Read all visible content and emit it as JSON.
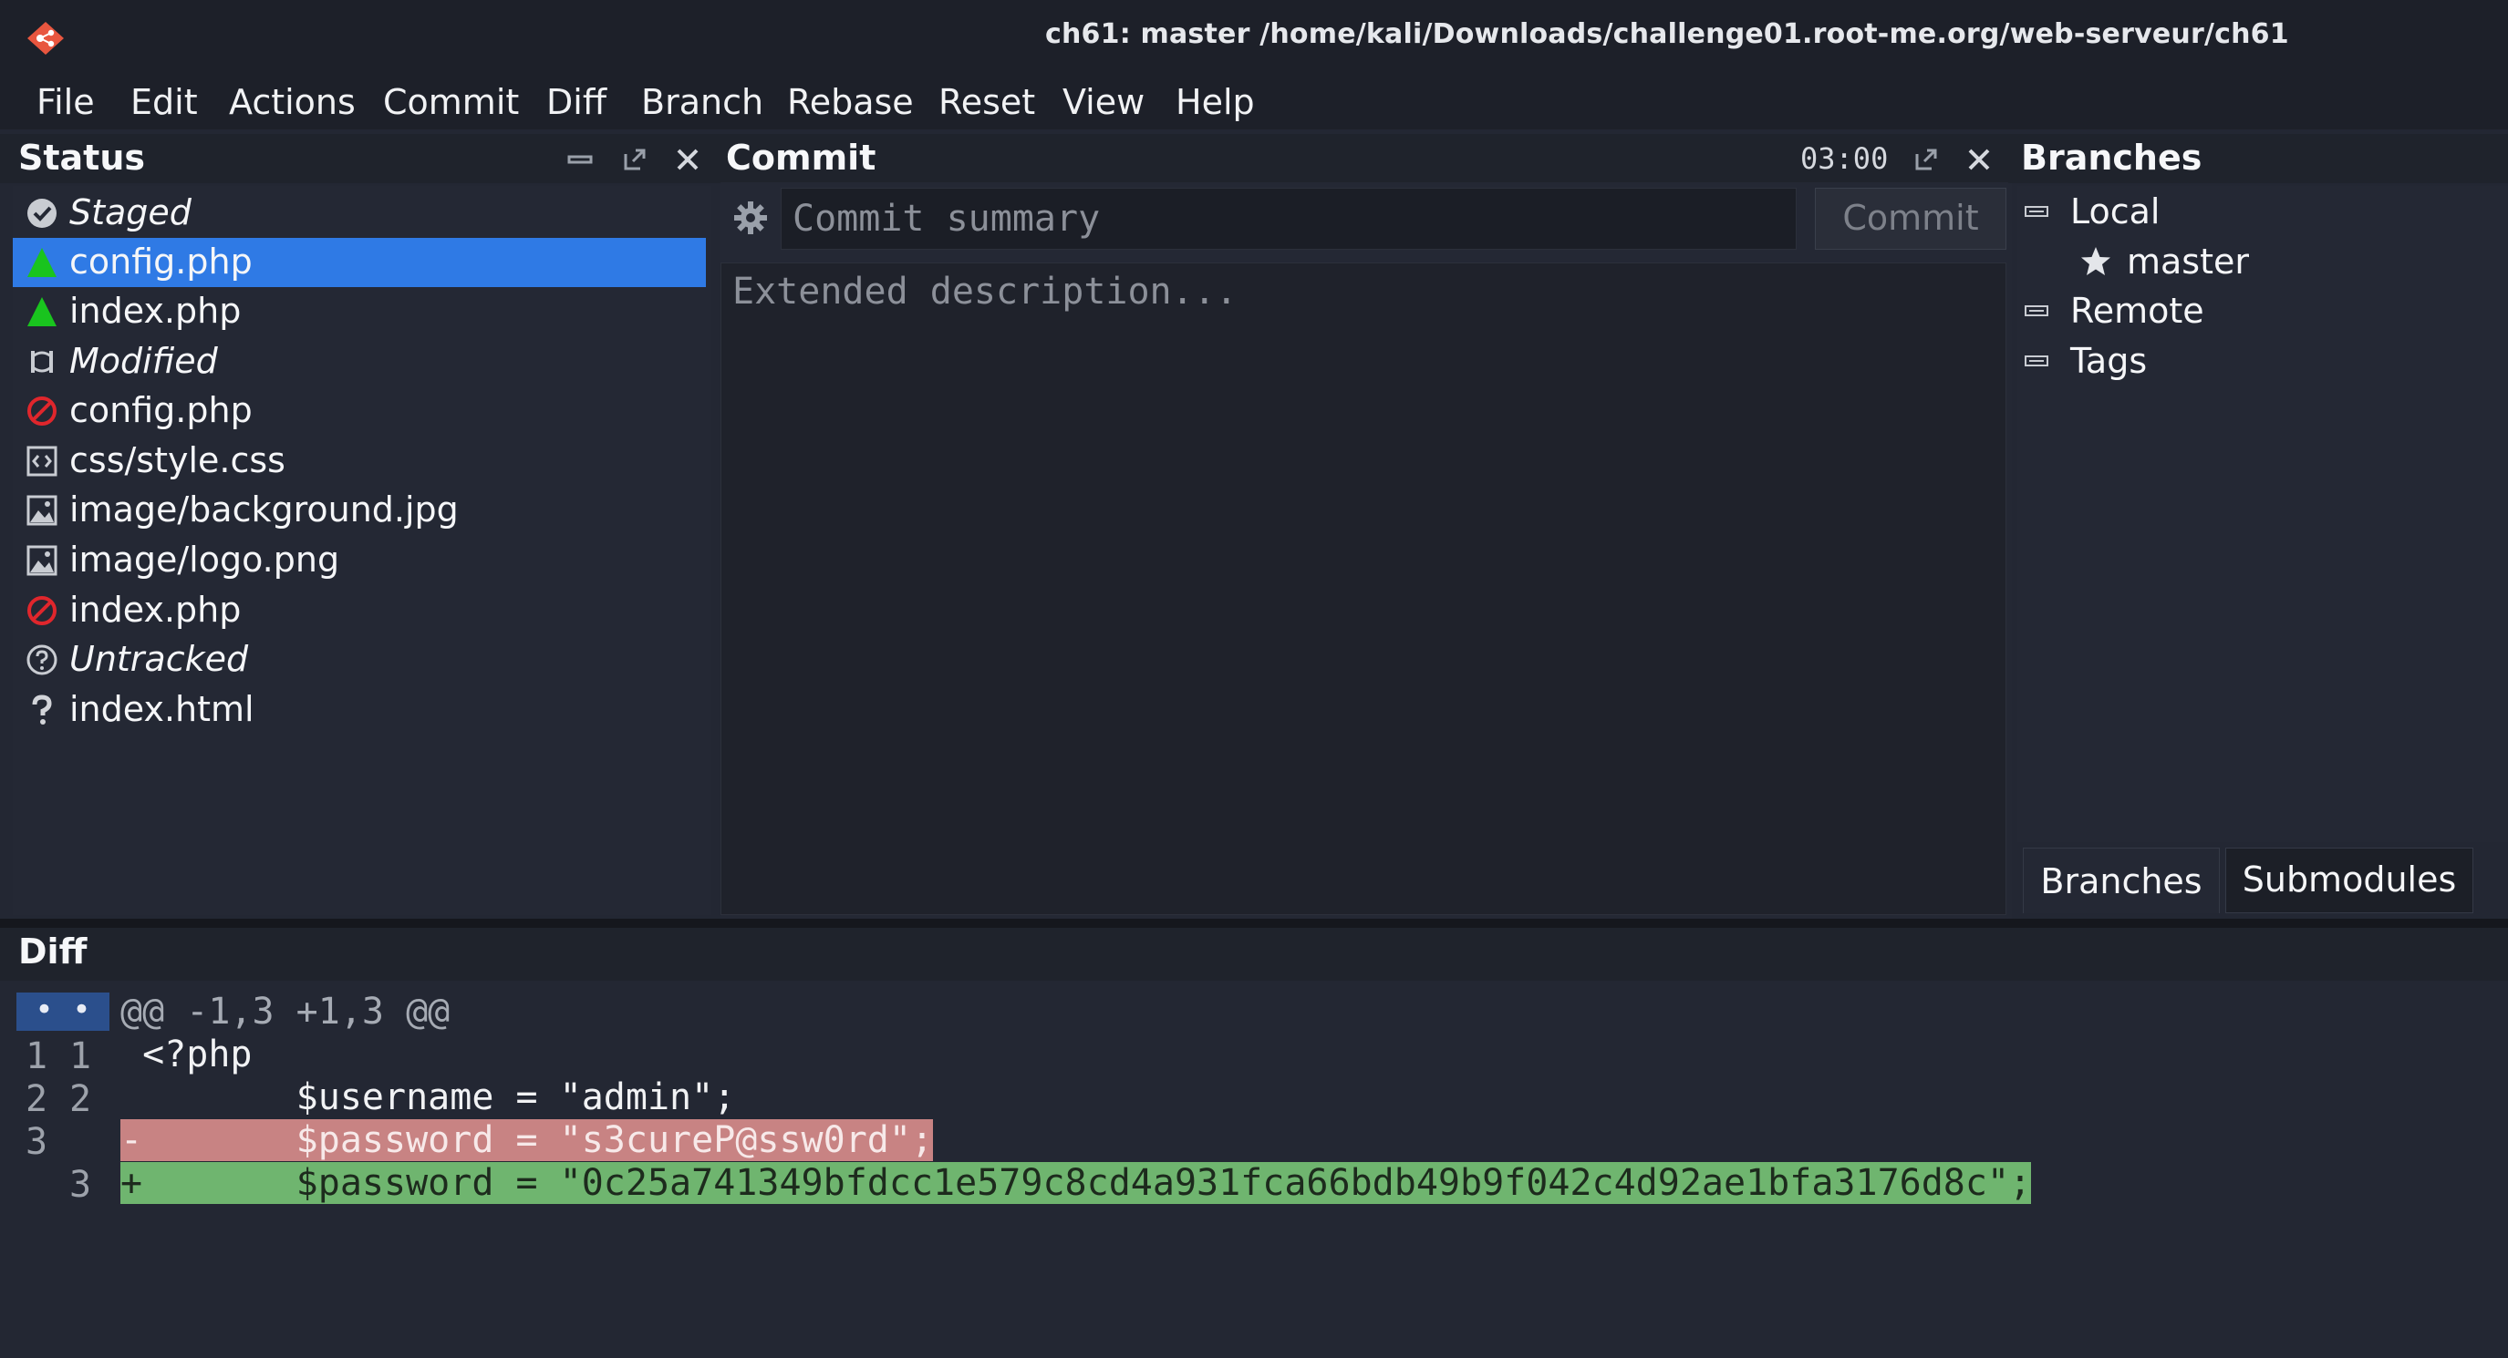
{
  "window": {
    "title": "ch61: master /home/kali/Downloads/challenge01.root-me.org/web-serveur/ch61"
  },
  "menu": [
    "File",
    "Edit",
    "Actions",
    "Commit",
    "Diff",
    "Branch",
    "Rebase",
    "Reset",
    "View",
    "Help"
  ],
  "status_panel": {
    "title": "Status",
    "items": [
      {
        "label": "Staged",
        "type": "group",
        "icon": "check-circle-icon"
      },
      {
        "label": "config.php",
        "type": "file",
        "icon": "added-triangle-icon",
        "selected": true
      },
      {
        "label": "index.php",
        "type": "file",
        "icon": "added-triangle-icon"
      },
      {
        "label": "Modified",
        "type": "group",
        "icon": "modified-icon"
      },
      {
        "label": "config.php",
        "type": "file",
        "icon": "deleted-no-icon"
      },
      {
        "label": "css/style.css",
        "type": "file",
        "icon": "code-file-icon"
      },
      {
        "label": "image/background.jpg",
        "type": "file",
        "icon": "image-file-icon"
      },
      {
        "label": "image/logo.png",
        "type": "file",
        "icon": "image-file-icon"
      },
      {
        "label": "index.php",
        "type": "file",
        "icon": "deleted-no-icon"
      },
      {
        "label": "Untracked",
        "type": "group",
        "icon": "question-circle-icon"
      },
      {
        "label": "index.html",
        "type": "file",
        "icon": "question-mark-icon"
      }
    ]
  },
  "commit_panel": {
    "title": "Commit",
    "timer": "03:00",
    "summary_placeholder": "Commit summary",
    "description_placeholder": "Extended description...",
    "commit_button": "Commit"
  },
  "branches_panel": {
    "title": "Branches",
    "local_label": "Local",
    "current_branch": "master",
    "remote_label": "Remote",
    "tags_label": "Tags",
    "tabs": [
      "Branches",
      "Submodules"
    ]
  },
  "diff_panel": {
    "title": "Diff",
    "hunk_marker": "• •",
    "hunk_header": "@@ -1,3 +1,3 @@",
    "lines": [
      {
        "old": "1",
        "new": "1",
        "kind": "context",
        "text": " <?php"
      },
      {
        "old": "2",
        "new": "2",
        "kind": "context",
        "text": "        $username = \"admin\";"
      },
      {
        "old": "3",
        "new": "",
        "kind": "del",
        "text": "-       $password = \"s3cureP@ssw0rd\";"
      },
      {
        "old": "",
        "new": "3",
        "kind": "add",
        "text": "+       $password = \"0c25a741349bfdcc1e579c8cd4a931fca66bdb49b9f042c4d92ae1bfa3176d8c\";"
      }
    ]
  },
  "colors": {
    "selection": "#2f7ae5",
    "added_icon": "#19c41e",
    "deleted_icon": "#e0262c",
    "diff_removed": "#c88383",
    "diff_added": "#6fb56f"
  }
}
